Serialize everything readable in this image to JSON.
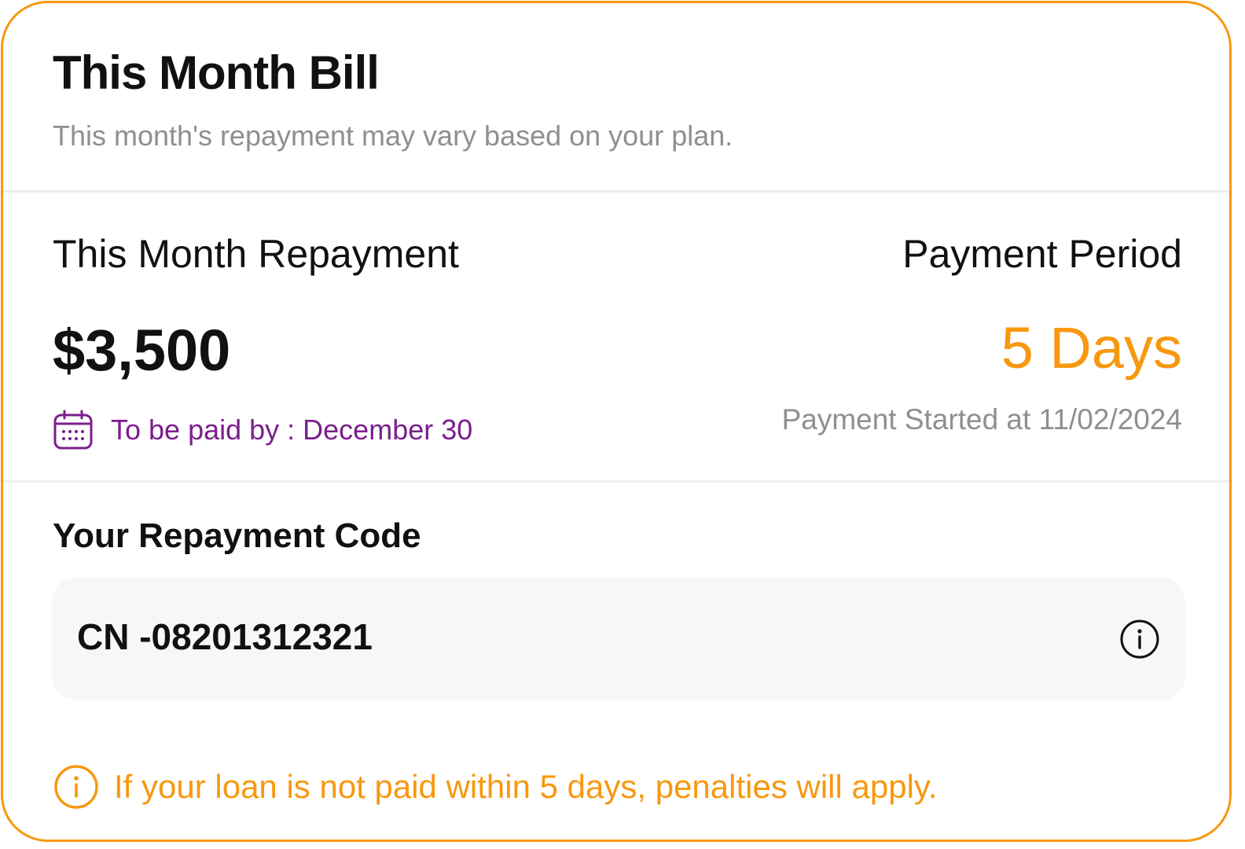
{
  "colors": {
    "accent": "#f7980f",
    "due_text": "#7b1f8c",
    "muted_text": "#8f8f8f",
    "primary_text": "#111111",
    "code_box_bg": "#f7f7f7",
    "divider": "#eeeeee"
  },
  "header": {
    "title": "This Month Bill",
    "subtitle": "This month's repayment may vary based on your plan."
  },
  "repayment": {
    "label": "This Month Repayment",
    "amount": "$3,500",
    "due_icon": "calendar-icon",
    "due_text": "To be paid by : December 30"
  },
  "period": {
    "label": "Payment Period",
    "value": "5 Days",
    "started": "Payment Started at 11/02/2024"
  },
  "code": {
    "label": "Your Repayment Code",
    "value": "CN -08201312321",
    "info_icon": "info-icon"
  },
  "warning": {
    "icon": "info-icon",
    "text": "If your loan is not paid within 5 days, penalties will apply."
  }
}
